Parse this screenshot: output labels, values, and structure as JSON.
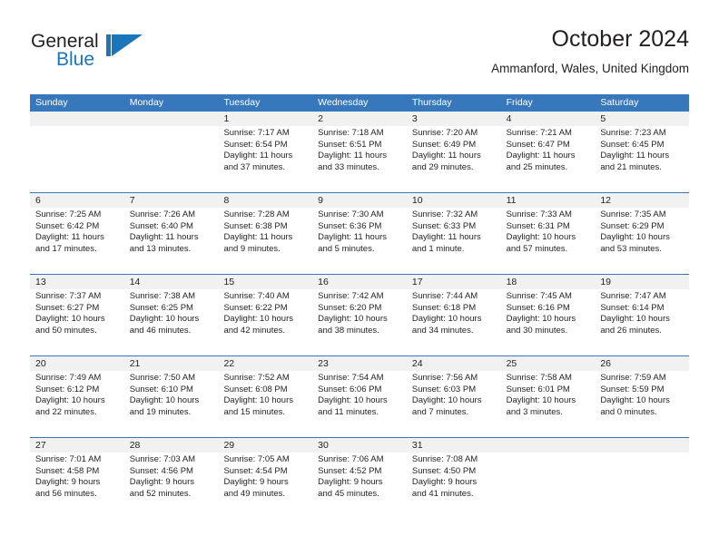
{
  "brand": {
    "name_part1": "General",
    "name_part2": "Blue",
    "mark": "triangle-flag-logo",
    "accent_color": "#1b75bb"
  },
  "header": {
    "title": "October 2024",
    "location": "Ammanford, Wales, United Kingdom"
  },
  "theme": {
    "header_blue": "#3778bc",
    "band_gray": "#f1f1f1",
    "text": "#231f20"
  },
  "weekdays": [
    "Sunday",
    "Monday",
    "Tuesday",
    "Wednesday",
    "Thursday",
    "Friday",
    "Saturday"
  ],
  "weeks": [
    [
      {
        "day": "",
        "sunrise": "",
        "sunset": "",
        "daylight1": "",
        "daylight2": ""
      },
      {
        "day": "",
        "sunrise": "",
        "sunset": "",
        "daylight1": "",
        "daylight2": ""
      },
      {
        "day": "1",
        "sunrise": "Sunrise: 7:17 AM",
        "sunset": "Sunset: 6:54 PM",
        "daylight1": "Daylight: 11 hours",
        "daylight2": "and 37 minutes."
      },
      {
        "day": "2",
        "sunrise": "Sunrise: 7:18 AM",
        "sunset": "Sunset: 6:51 PM",
        "daylight1": "Daylight: 11 hours",
        "daylight2": "and 33 minutes."
      },
      {
        "day": "3",
        "sunrise": "Sunrise: 7:20 AM",
        "sunset": "Sunset: 6:49 PM",
        "daylight1": "Daylight: 11 hours",
        "daylight2": "and 29 minutes."
      },
      {
        "day": "4",
        "sunrise": "Sunrise: 7:21 AM",
        "sunset": "Sunset: 6:47 PM",
        "daylight1": "Daylight: 11 hours",
        "daylight2": "and 25 minutes."
      },
      {
        "day": "5",
        "sunrise": "Sunrise: 7:23 AM",
        "sunset": "Sunset: 6:45 PM",
        "daylight1": "Daylight: 11 hours",
        "daylight2": "and 21 minutes."
      }
    ],
    [
      {
        "day": "6",
        "sunrise": "Sunrise: 7:25 AM",
        "sunset": "Sunset: 6:42 PM",
        "daylight1": "Daylight: 11 hours",
        "daylight2": "and 17 minutes."
      },
      {
        "day": "7",
        "sunrise": "Sunrise: 7:26 AM",
        "sunset": "Sunset: 6:40 PM",
        "daylight1": "Daylight: 11 hours",
        "daylight2": "and 13 minutes."
      },
      {
        "day": "8",
        "sunrise": "Sunrise: 7:28 AM",
        "sunset": "Sunset: 6:38 PM",
        "daylight1": "Daylight: 11 hours",
        "daylight2": "and 9 minutes."
      },
      {
        "day": "9",
        "sunrise": "Sunrise: 7:30 AM",
        "sunset": "Sunset: 6:36 PM",
        "daylight1": "Daylight: 11 hours",
        "daylight2": "and 5 minutes."
      },
      {
        "day": "10",
        "sunrise": "Sunrise: 7:32 AM",
        "sunset": "Sunset: 6:33 PM",
        "daylight1": "Daylight: 11 hours",
        "daylight2": "and 1 minute."
      },
      {
        "day": "11",
        "sunrise": "Sunrise: 7:33 AM",
        "sunset": "Sunset: 6:31 PM",
        "daylight1": "Daylight: 10 hours",
        "daylight2": "and 57 minutes."
      },
      {
        "day": "12",
        "sunrise": "Sunrise: 7:35 AM",
        "sunset": "Sunset: 6:29 PM",
        "daylight1": "Daylight: 10 hours",
        "daylight2": "and 53 minutes."
      }
    ],
    [
      {
        "day": "13",
        "sunrise": "Sunrise: 7:37 AM",
        "sunset": "Sunset: 6:27 PM",
        "daylight1": "Daylight: 10 hours",
        "daylight2": "and 50 minutes."
      },
      {
        "day": "14",
        "sunrise": "Sunrise: 7:38 AM",
        "sunset": "Sunset: 6:25 PM",
        "daylight1": "Daylight: 10 hours",
        "daylight2": "and 46 minutes."
      },
      {
        "day": "15",
        "sunrise": "Sunrise: 7:40 AM",
        "sunset": "Sunset: 6:22 PM",
        "daylight1": "Daylight: 10 hours",
        "daylight2": "and 42 minutes."
      },
      {
        "day": "16",
        "sunrise": "Sunrise: 7:42 AM",
        "sunset": "Sunset: 6:20 PM",
        "daylight1": "Daylight: 10 hours",
        "daylight2": "and 38 minutes."
      },
      {
        "day": "17",
        "sunrise": "Sunrise: 7:44 AM",
        "sunset": "Sunset: 6:18 PM",
        "daylight1": "Daylight: 10 hours",
        "daylight2": "and 34 minutes."
      },
      {
        "day": "18",
        "sunrise": "Sunrise: 7:45 AM",
        "sunset": "Sunset: 6:16 PM",
        "daylight1": "Daylight: 10 hours",
        "daylight2": "and 30 minutes."
      },
      {
        "day": "19",
        "sunrise": "Sunrise: 7:47 AM",
        "sunset": "Sunset: 6:14 PM",
        "daylight1": "Daylight: 10 hours",
        "daylight2": "and 26 minutes."
      }
    ],
    [
      {
        "day": "20",
        "sunrise": "Sunrise: 7:49 AM",
        "sunset": "Sunset: 6:12 PM",
        "daylight1": "Daylight: 10 hours",
        "daylight2": "and 22 minutes."
      },
      {
        "day": "21",
        "sunrise": "Sunrise: 7:50 AM",
        "sunset": "Sunset: 6:10 PM",
        "daylight1": "Daylight: 10 hours",
        "daylight2": "and 19 minutes."
      },
      {
        "day": "22",
        "sunrise": "Sunrise: 7:52 AM",
        "sunset": "Sunset: 6:08 PM",
        "daylight1": "Daylight: 10 hours",
        "daylight2": "and 15 minutes."
      },
      {
        "day": "23",
        "sunrise": "Sunrise: 7:54 AM",
        "sunset": "Sunset: 6:06 PM",
        "daylight1": "Daylight: 10 hours",
        "daylight2": "and 11 minutes."
      },
      {
        "day": "24",
        "sunrise": "Sunrise: 7:56 AM",
        "sunset": "Sunset: 6:03 PM",
        "daylight1": "Daylight: 10 hours",
        "daylight2": "and 7 minutes."
      },
      {
        "day": "25",
        "sunrise": "Sunrise: 7:58 AM",
        "sunset": "Sunset: 6:01 PM",
        "daylight1": "Daylight: 10 hours",
        "daylight2": "and 3 minutes."
      },
      {
        "day": "26",
        "sunrise": "Sunrise: 7:59 AM",
        "sunset": "Sunset: 5:59 PM",
        "daylight1": "Daylight: 10 hours",
        "daylight2": "and 0 minutes."
      }
    ],
    [
      {
        "day": "27",
        "sunrise": "Sunrise: 7:01 AM",
        "sunset": "Sunset: 4:58 PM",
        "daylight1": "Daylight: 9 hours",
        "daylight2": "and 56 minutes."
      },
      {
        "day": "28",
        "sunrise": "Sunrise: 7:03 AM",
        "sunset": "Sunset: 4:56 PM",
        "daylight1": "Daylight: 9 hours",
        "daylight2": "and 52 minutes."
      },
      {
        "day": "29",
        "sunrise": "Sunrise: 7:05 AM",
        "sunset": "Sunset: 4:54 PM",
        "daylight1": "Daylight: 9 hours",
        "daylight2": "and 49 minutes."
      },
      {
        "day": "30",
        "sunrise": "Sunrise: 7:06 AM",
        "sunset": "Sunset: 4:52 PM",
        "daylight1": "Daylight: 9 hours",
        "daylight2": "and 45 minutes."
      },
      {
        "day": "31",
        "sunrise": "Sunrise: 7:08 AM",
        "sunset": "Sunset: 4:50 PM",
        "daylight1": "Daylight: 9 hours",
        "daylight2": "and 41 minutes."
      },
      {
        "day": "",
        "sunrise": "",
        "sunset": "",
        "daylight1": "",
        "daylight2": ""
      },
      {
        "day": "",
        "sunrise": "",
        "sunset": "",
        "daylight1": "",
        "daylight2": ""
      }
    ]
  ]
}
